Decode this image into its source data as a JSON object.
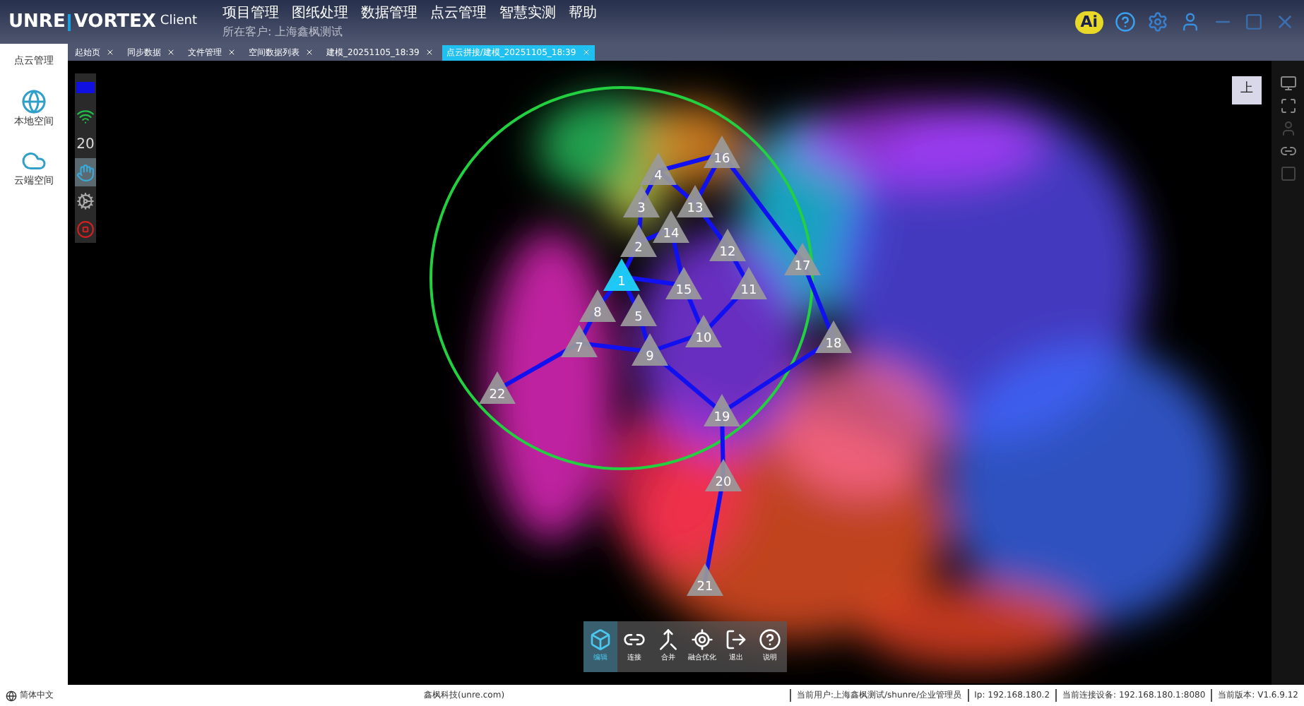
{
  "app": {
    "logo_left": "UNRE",
    "logo_right": "VORTEX",
    "logo_suffix": "Client",
    "customer": "所在客户: 上海鑫枫测试",
    "ai_badge": "Ai"
  },
  "menu": [
    "项目管理",
    "图纸处理",
    "数据管理",
    "点云管理",
    "智慧实测",
    "帮助"
  ],
  "tabs": [
    {
      "label": "起始页",
      "selected": false
    },
    {
      "label": "同步数据",
      "selected": false
    },
    {
      "label": "文件管理",
      "selected": false
    },
    {
      "label": "空间数据列表",
      "selected": false
    },
    {
      "label": "建模_20251105_18:39",
      "selected": false
    },
    {
      "label": "点云拼接/建模_20251105_18:39",
      "selected": true
    }
  ],
  "sidebar": {
    "title": "点云管理",
    "items": [
      {
        "label": "本地空间",
        "kind": "local"
      },
      {
        "label": "云端空间",
        "kind": "cloud"
      }
    ]
  },
  "left_toolbar": [
    {
      "kind": "blue"
    },
    {
      "kind": "wifi"
    },
    {
      "kind": "count",
      "text": "20"
    },
    {
      "kind": "hand",
      "selected": true
    },
    {
      "kind": "gear"
    },
    {
      "kind": "stop"
    }
  ],
  "view_button": "上",
  "stations": [
    {
      "label": "16",
      "selected": false
    },
    {
      "label": "4",
      "selected": false
    },
    {
      "label": "3",
      "selected": false
    },
    {
      "label": "13",
      "selected": false
    },
    {
      "label": "14",
      "selected": false
    },
    {
      "label": "2",
      "selected": false
    },
    {
      "label": "12",
      "selected": false
    },
    {
      "label": "17",
      "selected": false
    },
    {
      "label": "1",
      "selected": true
    },
    {
      "label": "15",
      "selected": false
    },
    {
      "label": "11",
      "selected": false
    },
    {
      "label": "8",
      "selected": false
    },
    {
      "label": "5",
      "selected": false
    },
    {
      "label": "10",
      "selected": false
    },
    {
      "label": "7",
      "selected": false
    },
    {
      "label": "18",
      "selected": false
    },
    {
      "label": "9",
      "selected": false
    },
    {
      "label": "22",
      "selected": false
    },
    {
      "label": "19",
      "selected": false
    },
    {
      "label": "20",
      "selected": false
    },
    {
      "label": "21",
      "selected": false
    }
  ],
  "bottom_toolbar": [
    {
      "label": "编辑",
      "kind": "cube",
      "selected": true
    },
    {
      "label": "连接",
      "kind": "link",
      "selected": false
    },
    {
      "label": "合并",
      "kind": "merge",
      "selected": false
    },
    {
      "label": "融合优化",
      "kind": "target",
      "selected": false
    },
    {
      "label": "退出",
      "kind": "exit",
      "selected": false
    },
    {
      "label": "说明",
      "kind": "help",
      "selected": false
    }
  ],
  "status_bar": {
    "language": "简体中文",
    "company": "鑫枫科技(unre.com)",
    "items": [
      "当前用户:上海鑫枫测试/shunre/企业管理员",
      "Ip: 192.168.180.2",
      "当前连接设备: 192.168.180.1:8080",
      "当前版本: V1.6.9.12"
    ]
  }
}
